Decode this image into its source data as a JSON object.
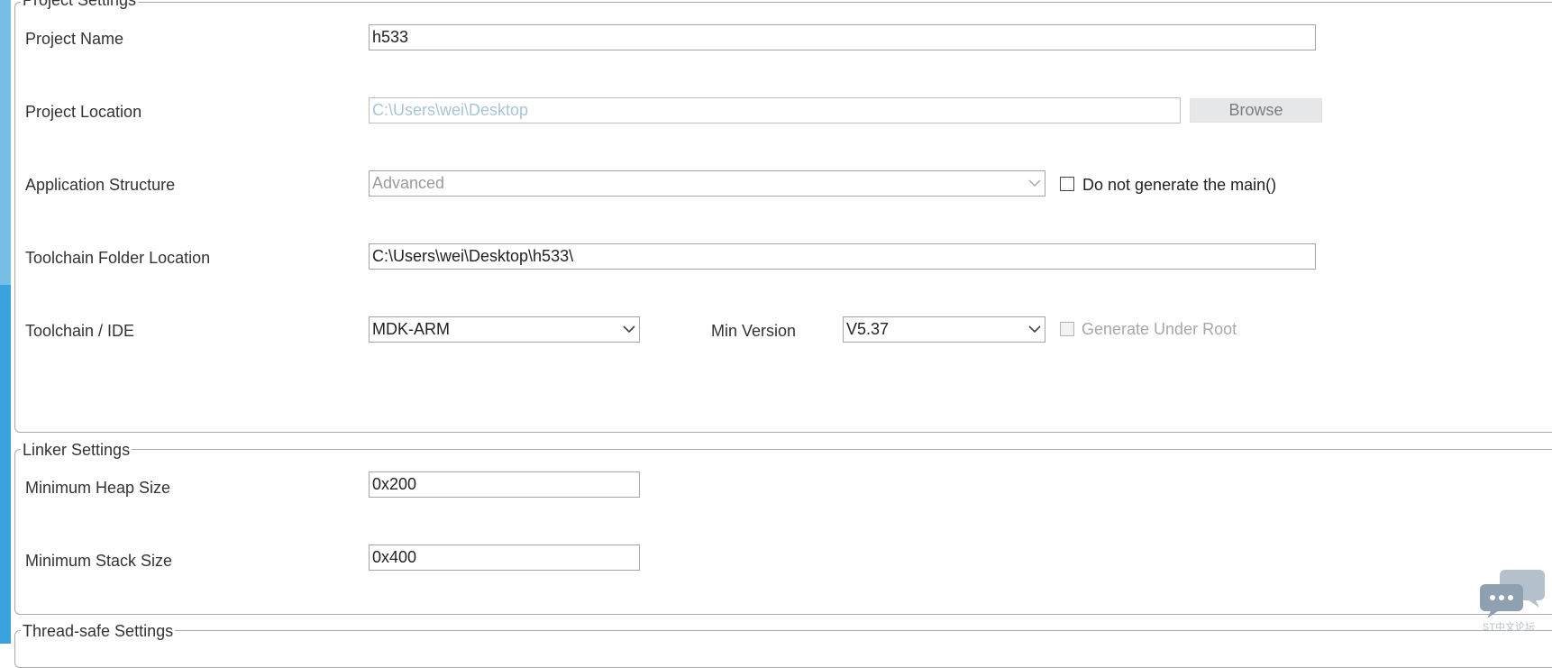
{
  "project_settings": {
    "title": "Project Settings",
    "project_name": {
      "label": "Project Name",
      "value": "h533"
    },
    "project_location": {
      "label": "Project Location",
      "value": "C:\\Users\\wei\\Desktop",
      "browse_label": "Browse"
    },
    "application_structure": {
      "label": "Application Structure",
      "value": "Advanced",
      "checkbox_label": "Do not generate the main()",
      "checkbox_checked": false
    },
    "toolchain_folder": {
      "label": "Toolchain Folder Location",
      "value": "C:\\Users\\wei\\Desktop\\h533\\"
    },
    "toolchain_ide": {
      "label": "Toolchain / IDE",
      "value": "MDK-ARM",
      "min_version_label": "Min Version",
      "min_version_value": "V5.37",
      "generate_root_label": "Generate Under Root",
      "generate_root_checked": false
    }
  },
  "linker_settings": {
    "title": "Linker Settings",
    "heap": {
      "label": "Minimum Heap Size",
      "value": "0x200"
    },
    "stack": {
      "label": "Minimum Stack Size",
      "value": "0x400"
    }
  },
  "thread_safe_settings": {
    "title": "Thread-safe Settings"
  },
  "watermark": {
    "text": "ST中文论坛",
    "icon": "chat-bubbles-icon"
  }
}
